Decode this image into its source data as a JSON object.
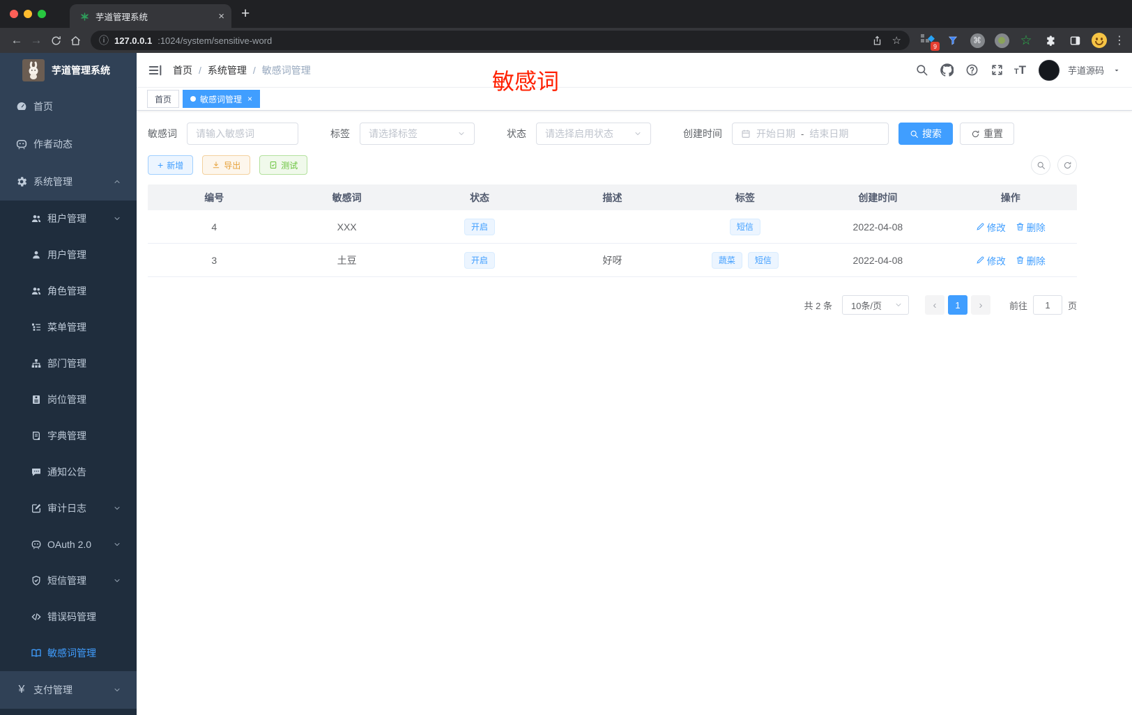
{
  "browser": {
    "tab_title": "芋道管理系统",
    "url_host": "127.0.0.1",
    "url_path": ":1024/system/sensitive-word",
    "ext_badge": "9"
  },
  "sidebar": {
    "title": "芋道管理系统",
    "items": [
      {
        "label": "首页"
      },
      {
        "label": "作者动态"
      },
      {
        "label": "系统管理"
      },
      {
        "label": "租户管理"
      },
      {
        "label": "用户管理"
      },
      {
        "label": "角色管理"
      },
      {
        "label": "菜单管理"
      },
      {
        "label": "部门管理"
      },
      {
        "label": "岗位管理"
      },
      {
        "label": "字典管理"
      },
      {
        "label": "通知公告"
      },
      {
        "label": "审计日志"
      },
      {
        "label": "OAuth 2.0"
      },
      {
        "label": "短信管理"
      },
      {
        "label": "错误码管理"
      },
      {
        "label": "敏感词管理"
      },
      {
        "label": "支付管理"
      }
    ]
  },
  "header": {
    "breadcrumb": [
      "首页",
      "系统管理",
      "敏感词管理"
    ],
    "username": "芋道源码"
  },
  "tabbar": {
    "tabs": [
      {
        "label": "首页"
      },
      {
        "label": "敏感词管理"
      }
    ]
  },
  "annotation": "敏感词",
  "filters": {
    "keyword_label": "敏感词",
    "keyword_placeholder": "请输入敏感词",
    "tag_label": "标签",
    "tag_placeholder": "请选择标签",
    "status_label": "状态",
    "status_placeholder": "请选择启用状态",
    "date_label": "创建时间",
    "date_start": "开始日期",
    "date_sep": "-",
    "date_end": "结束日期",
    "search_label": "搜索",
    "reset_label": "重置"
  },
  "toolbar": {
    "add_label": "新增",
    "export_label": "导出",
    "test_label": "测试"
  },
  "table": {
    "headers": [
      "编号",
      "敏感词",
      "状态",
      "描述",
      "标签",
      "创建时间",
      "操作"
    ],
    "rows": [
      {
        "id": "4",
        "word": "XXX",
        "status": "开启",
        "desc": "",
        "tags": [
          "短信"
        ],
        "created": "2022-04-08",
        "edit": "修改",
        "delete": "删除"
      },
      {
        "id": "3",
        "word": "土豆",
        "status": "开启",
        "desc": "好呀",
        "tags": [
          "蔬菜",
          "短信"
        ],
        "created": "2022-04-08",
        "edit": "修改",
        "delete": "删除"
      }
    ]
  },
  "pagination": {
    "total": "共 2 条",
    "page_size": "10条/页",
    "page": "1",
    "goto_label": "前往",
    "goto_value": "1",
    "unit_label": "页"
  },
  "colors": {
    "primary": "#409eff",
    "warning": "#e6a23c",
    "success": "#67c23a",
    "sidebar_bg": "#304156",
    "sidebar_submenu_bg": "#1f2d3d",
    "annotation_red": "#ff2000"
  }
}
